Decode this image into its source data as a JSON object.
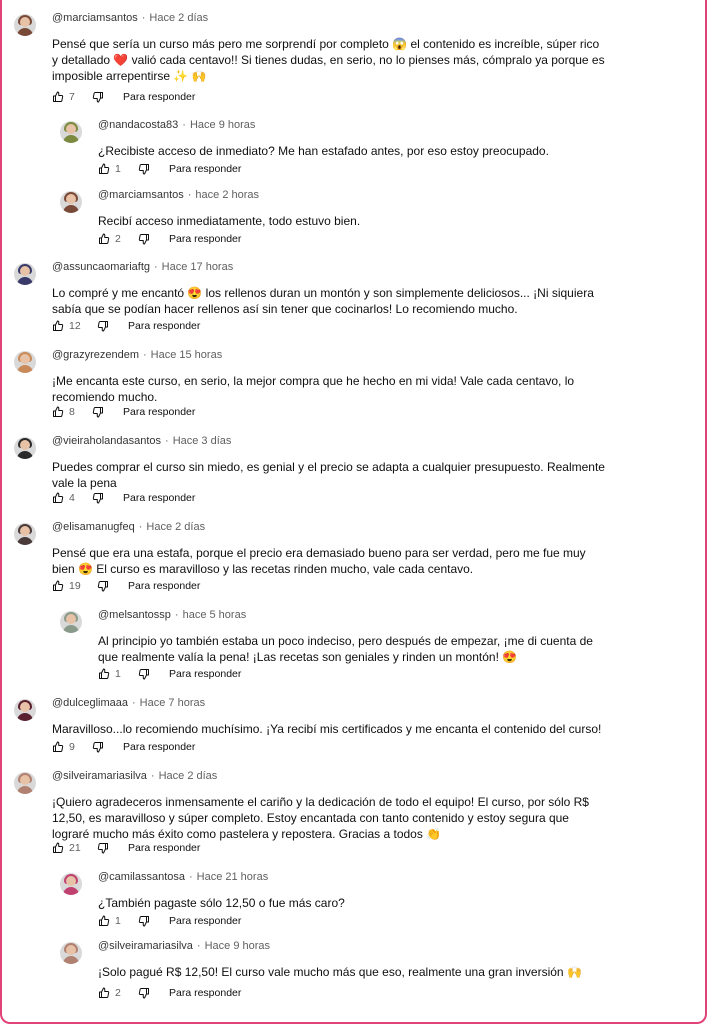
{
  "comments": [
    {
      "handle": "@marciamsantos",
      "time": "Hace 2 días",
      "text": "Pensé que sería un curso más pero me sorprendí por completo 😱 el contenido es increíble, súper rico y detallado ❤️ valió cada centavo!! Si tienes dudas, en serio, no lo pienses más, cómpralo ya porque es imposible arrepentirse ✨ 🙌",
      "likes": "7",
      "reply_label": "Para responder",
      "avatar_color": "#7a4a38"
    },
    {
      "handle": "@nandacosta83",
      "time": "Hace 9 horas",
      "text": "¿Recibiste acceso de inmediato? Me han estafado antes, por eso estoy preocupado.",
      "likes": "1",
      "reply_label": "Para responder",
      "avatar_color": "#7b8a3e"
    },
    {
      "handle": "@marciamsantos",
      "time": "hace 2 horas",
      "text": "Recibí acceso inmediatamente, todo estuvo bien.",
      "likes": "2",
      "reply_label": "Para responder",
      "avatar_color": "#7a4a38"
    },
    {
      "handle": "@assuncaomariaftg",
      "time": "Hace 17 horas",
      "text": "Lo compré y me encantó 😍 los rellenos duran un montón y son simplemente deliciosos... ¡Ni siquiera sabía que se podían hacer rellenos así sin tener que cocinarlos! Lo recomiendo mucho.",
      "likes": "12",
      "reply_label": "Para responder",
      "avatar_color": "#3a3a6a"
    },
    {
      "handle": "@grazyrezendem",
      "time": "Hace 15 horas",
      "text": "¡Me encanta este curso, en serio, la mejor compra que he hecho en mi vida! Vale cada centavo, lo recomiendo mucho.",
      "likes": "8",
      "reply_label": "Para responder",
      "avatar_color": "#c98a5a"
    },
    {
      "handle": "@vieiraholandasantos",
      "time": "Hace 3 días",
      "text": "Puedes comprar el curso sin miedo, es genial y el precio se adapta a cualquier presupuesto. Realmente vale la pena",
      "likes": "4",
      "reply_label": "Para responder",
      "avatar_color": "#2a2a2a"
    },
    {
      "handle": "@elisamanugfeq",
      "time": "Hace 2 días",
      "text": "Pensé que era una estafa, porque el precio era demasiado bueno para ser verdad, pero me fue muy bien 😍 El curso es maravilloso y las recetas rinden mucho, vale cada centavo.",
      "likes": "19",
      "reply_label": "Para responder",
      "avatar_color": "#4a3a3a"
    },
    {
      "handle": "@melsantossp",
      "time": "hace 5 horas",
      "text": "Al principio yo también estaba un poco indeciso, pero después de empezar, ¡me di cuenta de que realmente valía la pena! ¡Las recetas son geniales y rinden un montón! 😍",
      "likes": "1",
      "reply_label": "Para responder",
      "avatar_color": "#8a9a8a"
    },
    {
      "handle": "@dulceglimaaa",
      "time": "Hace 7 horas",
      "text": "Maravilloso...lo recomiendo muchísimo. ¡Ya recibí mis certificados y me encanta el contenido del curso!",
      "likes": "9",
      "reply_label": "Para responder",
      "avatar_color": "#5a2030"
    },
    {
      "handle": "@silveiramariasilva",
      "time": "Hace 2 días",
      "text": "¡Quiero agradeceros inmensamente el cariño y la dedicación de todo el equipo! El curso, por sólo R$ 12,50, es maravilloso y súper completo. Estoy encantada con tanto contenido y estoy segura que lograré mucho más éxito como pastelera y repostera. Gracias a todos 👏",
      "likes": "21",
      "reply_label": "Para responder",
      "avatar_color": "#b08070"
    },
    {
      "handle": "@camilassantosa",
      "time": "Hace 21 horas",
      "text": "¿También pagaste sólo 12,50 o fue más caro?",
      "likes": "1",
      "reply_label": "Para responder",
      "avatar_color": "#c04070"
    },
    {
      "handle": "@silveiramariasilva",
      "time": "Hace 9 horas",
      "text": "¡Solo pagué R$ 12,50! El curso vale mucho más que eso, realmente una gran inversión 🙌",
      "likes": "2",
      "reply_label": "Para responder",
      "avatar_color": "#b08070"
    }
  ]
}
